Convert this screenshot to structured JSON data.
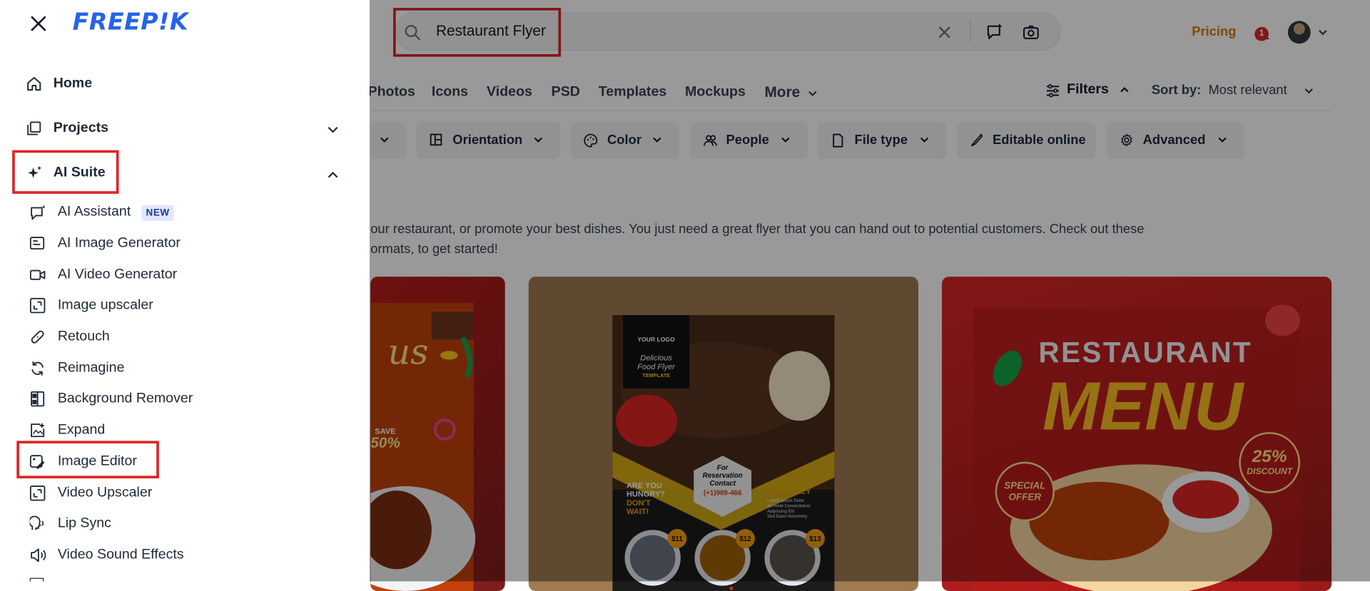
{
  "header": {
    "search_value": "Restaurant Flyer",
    "pricing_label": "Pricing",
    "notification_count": "1"
  },
  "tabs": [
    "Photos",
    "Icons",
    "Videos",
    "PSD",
    "Templates",
    "Mockups",
    "More"
  ],
  "filters": {
    "filters_label": "Filters",
    "sort_label": "Sort by:",
    "sort_value": "Most relevant"
  },
  "chips": [
    "Orientation",
    "Color",
    "People",
    "File type",
    "Editable online",
    "Advanced"
  ],
  "description": {
    "line1": "our restaurant, or promote your best dishes. You just need a great flyer that you can hand out to potential customers. Check out these",
    "line2": "ormats, to get started!"
  },
  "cards": [
    {
      "texts": [
        "SAVE",
        "50%"
      ]
    },
    {
      "texts": [
        "YOUR LOGO",
        "Delicious",
        "Food Flyer",
        "TEMPLATE",
        "For",
        "Reservation",
        "Contact",
        "(+1)989-466",
        "ARE YOU",
        "HUNGRY?",
        "DON'T",
        "WAIT!",
        "OUR POLICY",
        "Lorem Ipsum Dolor",
        "Sit Amet Consectetuer",
        "Adipiscing Elit",
        "Sed Diam Nonummy",
        "$11",
        "$12",
        "$13"
      ]
    },
    {
      "texts": [
        "RESTAURANT",
        "MENU",
        "25%",
        "DISCOUNT",
        "SPECIAL",
        "OFFER"
      ]
    }
  ],
  "sidebar": {
    "logo": "FREEP!K",
    "nav": [
      {
        "label": "Home"
      },
      {
        "label": "Projects"
      },
      {
        "label": "AI Suite"
      }
    ],
    "ai_suite_items": [
      {
        "label": "AI Assistant",
        "badge": "NEW"
      },
      {
        "label": "AI Image Generator"
      },
      {
        "label": "AI Video Generator"
      },
      {
        "label": "Image upscaler"
      },
      {
        "label": "Retouch"
      },
      {
        "label": "Reimagine"
      },
      {
        "label": "Background Remover"
      },
      {
        "label": "Expand"
      },
      {
        "label": "Image Editor"
      },
      {
        "label": "Video Upscaler"
      },
      {
        "label": "Lip Sync"
      },
      {
        "label": "Video Sound Effects"
      }
    ]
  },
  "colors": {
    "brand": "#2563eb",
    "highlight": "#dc2626",
    "pricing": "#d97706"
  }
}
